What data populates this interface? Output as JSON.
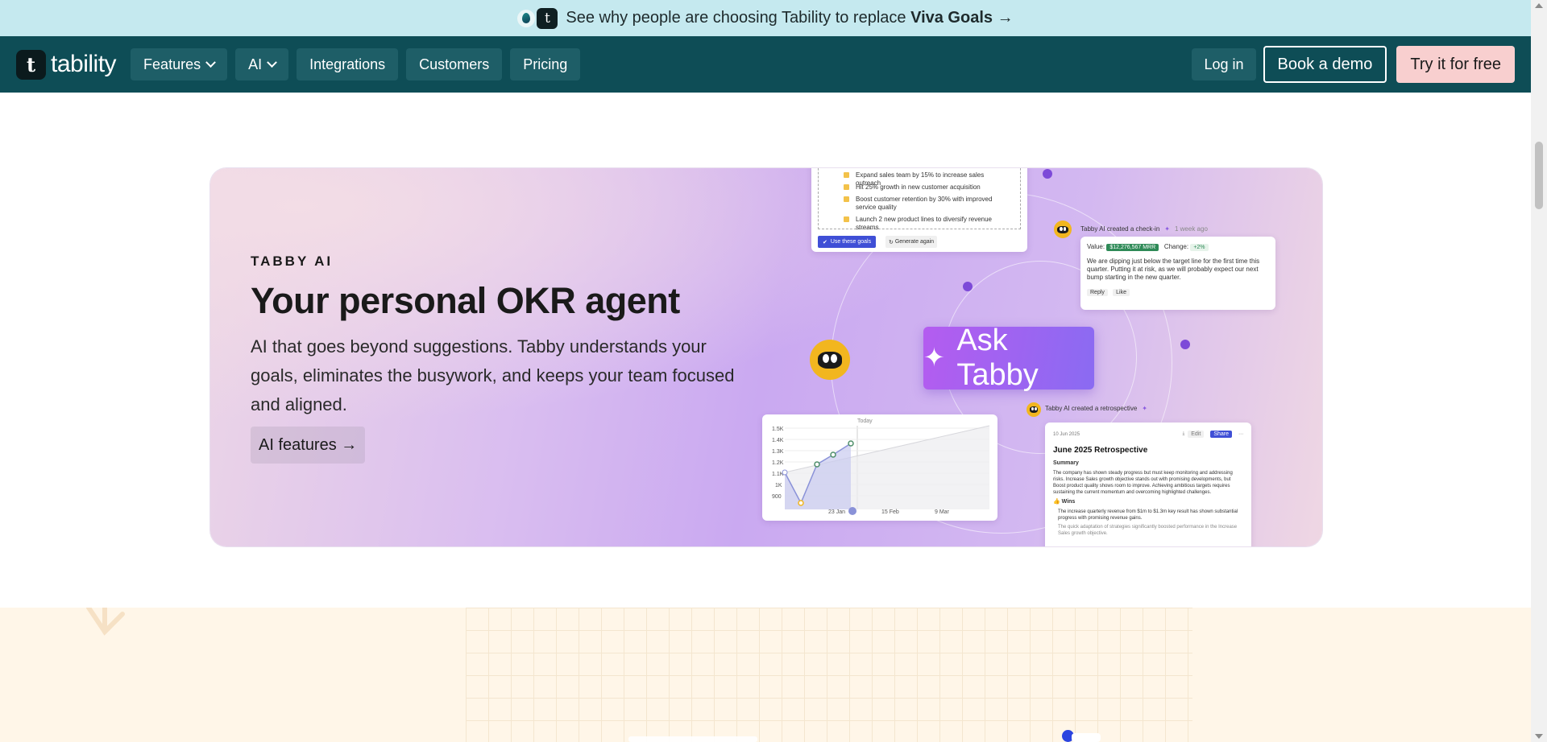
{
  "announcement": {
    "text_before": "See why people are choosing Tability to replace ",
    "text_bold": "Viva Goals",
    "arrow": "→"
  },
  "nav": {
    "brand": "tability",
    "brand_mark": "t",
    "items": [
      {
        "label": "Features",
        "has_dropdown": true
      },
      {
        "label": "AI",
        "has_dropdown": true
      },
      {
        "label": "Integrations",
        "has_dropdown": false
      },
      {
        "label": "Customers",
        "has_dropdown": false
      },
      {
        "label": "Pricing",
        "has_dropdown": false
      }
    ],
    "login": "Log in",
    "demo": "Book a demo",
    "try": "Try it for free"
  },
  "hero": {
    "eyebrow": "TABBY AI",
    "title": "Your personal OKR agent",
    "lead": "AI that goes beyond suggestions. Tabby understands your goals, eliminates the busywork, and keeps your team focused and aligned.",
    "cta": "AI features →"
  },
  "collage": {
    "goals": [
      "Expand sales team by 15% to increase sales outreach",
      "Hit 25% growth in new customer acquisition",
      "Boost customer retention by 30% with improved service quality",
      "Launch 2 new product lines to diversify revenue streams"
    ],
    "use_goals": "Use these goals",
    "generate_again": "Generate again",
    "ask_tabby": "Ask Tabby",
    "checkin": {
      "author": "Tabby AI created a check-in",
      "time": "1 week ago",
      "value_label": "Value:",
      "value": "$12,276,567 MRR",
      "change_label": "Change:",
      "change": "+2%",
      "text": "We are dipping just below the target line for the first time this quarter. Putting it at risk, as we will probably expect our next bump starting in the new quarter.",
      "reply": "Reply",
      "like": "Like"
    },
    "retro": {
      "author": "Tabby AI created a retrospective",
      "date": "10 Jun 2025",
      "edit": "Edit",
      "share": "Share",
      "title": "June 2025 Retrospective",
      "summary_label": "Summary",
      "summary": "The company has shown steady progress but must keep monitoring and addressing risks. Increase Sales growth objective stands out with promising developments, but Boost product quality shows room to improve. Achieving ambitious targets requires sustaining the current momentum and overcoming highlighted challenges.",
      "wins_label": "👍 Wins",
      "wins": [
        "The increase quarterly revenue from $1m to $1.3m key result has shown substantial progress with promising revenue gains.",
        "The quick adaptation of strategies significantly boosted performance in the Increase Sales growth objective."
      ]
    },
    "chart": {
      "today_label": "Today",
      "y_ticks": [
        "1.5K",
        "1.4K",
        "1.3K",
        "1.2K",
        "1.1K",
        "1K",
        "900"
      ],
      "x_ticks": [
        "23 Jan",
        "15 Feb",
        "9 Mar"
      ]
    }
  }
}
